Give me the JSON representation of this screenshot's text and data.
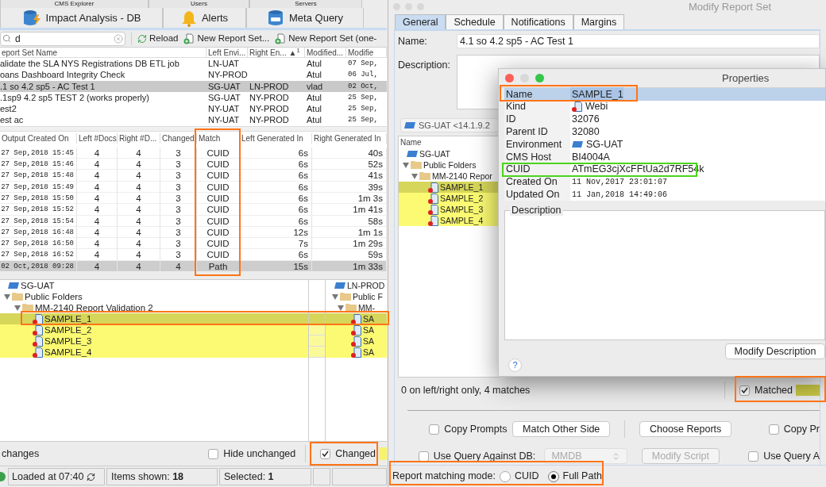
{
  "app": {
    "tabs_top": [
      {
        "label": "CMS Explorer",
        "selected": false
      },
      {
        "label": "Users",
        "selected": false
      },
      {
        "label": "Servers",
        "selected": false
      }
    ],
    "tabs": [
      {
        "label": "Impact Analysis - DB",
        "kind": "impact",
        "selected": false
      },
      {
        "label": "Alerts",
        "kind": "alerts",
        "selected": false
      },
      {
        "label": "Meta Query",
        "kind": "query",
        "selected": false
      }
    ],
    "search": {
      "value": "d"
    },
    "toolbar": [
      {
        "label": "Reload",
        "kind": "reload"
      },
      {
        "label": "New Report Set...",
        "kind": "new"
      },
      {
        "label": "New Report Set (one-",
        "kind": "new"
      }
    ],
    "report_sets": {
      "columns": [
        "eport Set Name",
        "Left Envi...",
        "Right En... ▲$^{1}$",
        "Modified...",
        "Modifie"
      ],
      "rows": [
        {
          "name": "alidate the SLA NYS Registrations DB ETL job",
          "left_env": "LN-UAT",
          "modified_by": "Atul",
          "modified_on": "07 Sep,",
          "selected": false
        },
        {
          "name": "oans Dashboard Integrity Check",
          "left_env": "NY-PROD",
          "modified_by": "Atul",
          "modified_on": "06 Jul,",
          "selected": false
        },
        {
          "name": ".1 so 4.2 sp5 - AC Test 1",
          "left_env": "SG-UAT",
          "right_env": "LN-PROD",
          "modified_by": "vlad",
          "modified_on": "02 Oct,",
          "selected": true
        },
        {
          "name": ".1sp9 4.2 sp5 TEST 2  (works properly)",
          "left_env": "SG-UAT",
          "right_env": "NY-PROD",
          "modified_by": "Atul",
          "modified_on": "25 Sep,",
          "selected": false
        },
        {
          "name": "est2",
          "left_env": "NY-UAT",
          "right_env": "NY-PROD",
          "modified_by": "Atul",
          "modified_on": "25 Sep,",
          "selected": false
        },
        {
          "name": "est ac",
          "left_env": "NY-UAT",
          "right_env": "NY-PROD",
          "modified_by": "Atul",
          "modified_on": "25 Sep,",
          "selected": false
        }
      ]
    },
    "outputs": {
      "columns": [
        "Output Created On",
        "Left #Docs",
        "Right #D...",
        "Changed",
        "Match",
        "Left Generated In",
        "Right Generated In"
      ],
      "rows": [
        {
          "cells": [
            "27 Sep,2018 15:45",
            "4",
            "4",
            "3",
            "CUID",
            "6s",
            "40s"
          ],
          "selected": false
        },
        {
          "cells": [
            "27 Sep,2018 15:46",
            "4",
            "4",
            "3",
            "CUID",
            "6s",
            "52s"
          ],
          "selected": false
        },
        {
          "cells": [
            "27 Sep,2018 15:48",
            "4",
            "4",
            "3",
            "CUID",
            "6s",
            "41s"
          ],
          "selected": false
        },
        {
          "cells": [
            "27 Sep,2018 15:49",
            "4",
            "4",
            "3",
            "CUID",
            "6s",
            "39s"
          ],
          "selected": false
        },
        {
          "cells": [
            "27 Sep,2018 15:50",
            "4",
            "4",
            "3",
            "CUID",
            "6s",
            "1m 3s"
          ],
          "selected": false
        },
        {
          "cells": [
            "27 Sep,2018 15:52",
            "4",
            "4",
            "3",
            "CUID",
            "6s",
            "1m 41s"
          ],
          "selected": false
        },
        {
          "cells": [
            "27 Sep,2018 15:54",
            "4",
            "4",
            "3",
            "CUID",
            "6s",
            "58s"
          ],
          "selected": false
        },
        {
          "cells": [
            "27 Sep,2018 16:48",
            "4",
            "4",
            "3",
            "CUID",
            "12s",
            "1m 1s"
          ],
          "selected": false
        },
        {
          "cells": [
            "27 Sep,2018 16:50",
            "4",
            "4",
            "3",
            "CUID",
            "7s",
            "1m 29s"
          ],
          "selected": false
        },
        {
          "cells": [
            "27 Sep,2018 16:52",
            "4",
            "4",
            "3",
            "CUID",
            "6s",
            "59s"
          ],
          "selected": false
        },
        {
          "cells": [
            "02 Oct,2018 09:28",
            "4",
            "4",
            "4",
            "Path",
            "15s",
            "1m 33s"
          ],
          "selected": true
        }
      ]
    },
    "left_tree": [
      {
        "label": "SG-UAT",
        "kind": "environment",
        "children": [
          {
            "label": "Public Folders",
            "kind": "folder",
            "expanded": true,
            "children": [
              {
                "label": "MM-2140 Report Validation 2",
                "kind": "folder",
                "expanded": true,
                "children": [
                  {
                    "label": "SAMPLE_1",
                    "kind": "report",
                    "selected": true
                  },
                  {
                    "label": "SAMPLE_2",
                    "kind": "report",
                    "selected": false
                  },
                  {
                    "label": "SAMPLE_3",
                    "kind": "report",
                    "selected": false
                  },
                  {
                    "label": "SAMPLE_4",
                    "kind": "report",
                    "selected": false
                  }
                ]
              }
            ]
          }
        ]
      }
    ],
    "right_tree": [
      {
        "label": "LN-PROD",
        "kind": "environment",
        "children": [
          {
            "label": "Public F",
            "kind": "folder",
            "expanded": true,
            "children": [
              {
                "label": "MM-",
                "kind": "folder",
                "expanded": true,
                "children": [
                  {
                    "label": "SA",
                    "kind": "report",
                    "selected": true
                  },
                  {
                    "label": "SA",
                    "kind": "report",
                    "selected": false
                  },
                  {
                    "label": "SA",
                    "kind": "report",
                    "selected": false
                  },
                  {
                    "label": "SA",
                    "kind": "report",
                    "selected": false
                  }
                ]
              }
            ]
          }
        ]
      }
    ],
    "summary": "changes",
    "filters": [
      {
        "label": "Hide unchanged",
        "checked": false
      },
      {
        "label": "Changed",
        "checked": true,
        "color": "#f7f36c"
      }
    ],
    "status": [
      "Loaded at 07:40",
      "Items shown: **18**",
      "Selected: **1**"
    ]
  },
  "modify": {
    "title": "Modify Report Set",
    "tabs": [
      {
        "label": "General",
        "selected": true
      },
      {
        "label": "Schedule",
        "selected": false
      },
      {
        "label": "Notifications",
        "selected": false
      },
      {
        "label": "Margins",
        "selected": false
      }
    ],
    "name_label": "Name:",
    "name": "4.1 so 4.2 sp5 - AC Test 1",
    "description_label": "Description:",
    "environment": "SG-UAT <14.1.9.2",
    "tree": {
      "column": "Name",
      "items": [
        {
          "label": "SG-UAT",
          "kind": "environment",
          "children": [
            {
              "label": "Public Folders",
              "kind": "folder",
              "expanded": true,
              "children": [
                {
                  "label": "MM-2140 Repor",
                  "kind": "folder",
                  "expanded": true,
                  "children": [
                    {
                      "label": "SAMPLE_1",
                      "kind": "report",
                      "selected": true
                    },
                    {
                      "label": "SAMPLE_2",
                      "kind": "report",
                      "selected": false
                    },
                    {
                      "label": "SAMPLE_3",
                      "kind": "report",
                      "selected": false
                    },
                    {
                      "label": "SAMPLE_4",
                      "kind": "report",
                      "selected": false
                    }
                  ]
                }
              ]
            }
          ]
        }
      ]
    },
    "summary": "0 on left/right only, 4 matches",
    "matched": {
      "label": "Matched",
      "checked": true,
      "color": "#c9c846"
    },
    "controls_1": [
      {
        "kind": "checkbox",
        "label": "Copy Prompts",
        "checked": false
      },
      {
        "kind": "button",
        "label": "Match Other Side",
        "disabled": false
      },
      {
        "kind": "button",
        "label": "Choose Reports",
        "disabled": false
      },
      {
        "kind": "checkbox",
        "label": "Copy Pr",
        "checked": false
      }
    ],
    "controls_2": [
      {
        "kind": "checkbox",
        "label": "Use Query Against DB:",
        "checked": false
      },
      {
        "kind": "select",
        "label": "MMDB",
        "disabled": true
      },
      {
        "kind": "button",
        "label": "Modify Script",
        "disabled": true
      },
      {
        "kind": "checkbox",
        "label": "Use Query A",
        "checked": false
      }
    ],
    "mode": {
      "label": "Report matching mode:",
      "options": [
        {
          "label": "CUID",
          "selected": false
        },
        {
          "label": "Full Path",
          "selected": true
        }
      ]
    }
  },
  "properties": {
    "title": "Properties",
    "rows": [
      {
        "label": "Name",
        "value": "SAMPLE_1",
        "kind": "text",
        "selected": true
      },
      {
        "label": "Kind",
        "value": "Webi",
        "kind": "report",
        "selected": false
      },
      {
        "label": "ID",
        "value": "32076",
        "kind": "text",
        "selected": false
      },
      {
        "label": "Parent ID",
        "value": "32080",
        "kind": "text",
        "selected": false
      },
      {
        "label": "Environment",
        "value": "SG-UAT",
        "kind": "environment",
        "selected": false
      },
      {
        "label": "CMS Host",
        "value": "BI4004A",
        "kind": "text",
        "selected": false
      },
      {
        "label": "CUID",
        "value": "ATmEG3cjXcFFtUa2d7RF54k",
        "kind": "text",
        "selected": false
      },
      {
        "label": "Created On",
        "value": "11 Nov,2017 23:01:07",
        "kind": "date",
        "selected": false
      },
      {
        "label": "Updated On",
        "value": "11 Jan,2018 14:49:06",
        "kind": "date",
        "selected": false
      }
    ],
    "description_label": "Description",
    "help": "?",
    "button": "Modify Description"
  },
  "annotations": [
    {
      "color": "#ff7417"
    },
    {
      "color": "#ff7417"
    },
    {
      "color": "#ff7417"
    },
    {
      "color": "#ff7417"
    },
    {
      "color": "#4cd41c"
    },
    {
      "color": "#ff7417"
    },
    {
      "color": "#ff7417"
    }
  ]
}
